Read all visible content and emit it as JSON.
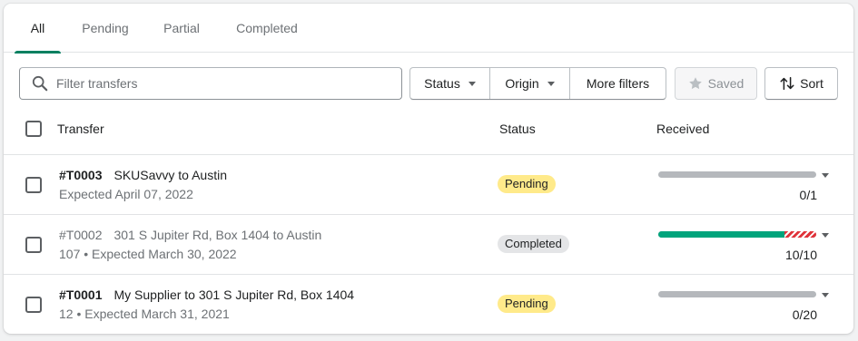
{
  "tabs": [
    {
      "label": "All",
      "active": true
    },
    {
      "label": "Pending",
      "active": false
    },
    {
      "label": "Partial",
      "active": false
    },
    {
      "label": "Completed",
      "active": false
    }
  ],
  "toolbar": {
    "search_placeholder": "Filter transfers",
    "status_label": "Status",
    "origin_label": "Origin",
    "more_filters_label": "More filters",
    "saved_label": "Saved",
    "sort_label": "Sort"
  },
  "table": {
    "headers": {
      "transfer": "Transfer",
      "status": "Status",
      "received": "Received"
    },
    "rows": [
      {
        "id": "#T0003",
        "route": "SKUSavvy to Austin",
        "detail": "Expected April 07, 2022",
        "status": "Pending",
        "status_type": "pending",
        "received_text": "0/1",
        "received_fraction": 0,
        "rejected_fraction": 0,
        "muted": false
      },
      {
        "id": "#T0002",
        "route": "301 S Jupiter Rd, Box 1404 to Austin",
        "detail": "107 • Expected March 30, 2022",
        "status": "Completed",
        "status_type": "completed",
        "received_text": "10/10",
        "received_fraction": 0.8,
        "rejected_fraction": 0.2,
        "muted": true
      },
      {
        "id": "#T0001",
        "route": "My Supplier to 301 S Jupiter Rd, Box 1404",
        "detail": "12 • Expected March 31, 2021",
        "status": "Pending",
        "status_type": "pending",
        "received_text": "0/20",
        "received_fraction": 0,
        "rejected_fraction": 0,
        "muted": false
      }
    ]
  },
  "colors": {
    "accent": "#008060",
    "received": "#00a47c",
    "rejected": "#e0333a",
    "pending_badge": "#ffea8a",
    "completed_badge": "#e4e5e7"
  },
  "icons": {
    "search": "search-icon",
    "star": "star-icon",
    "sort": "sort-icon",
    "caret": "caret-down-icon"
  }
}
